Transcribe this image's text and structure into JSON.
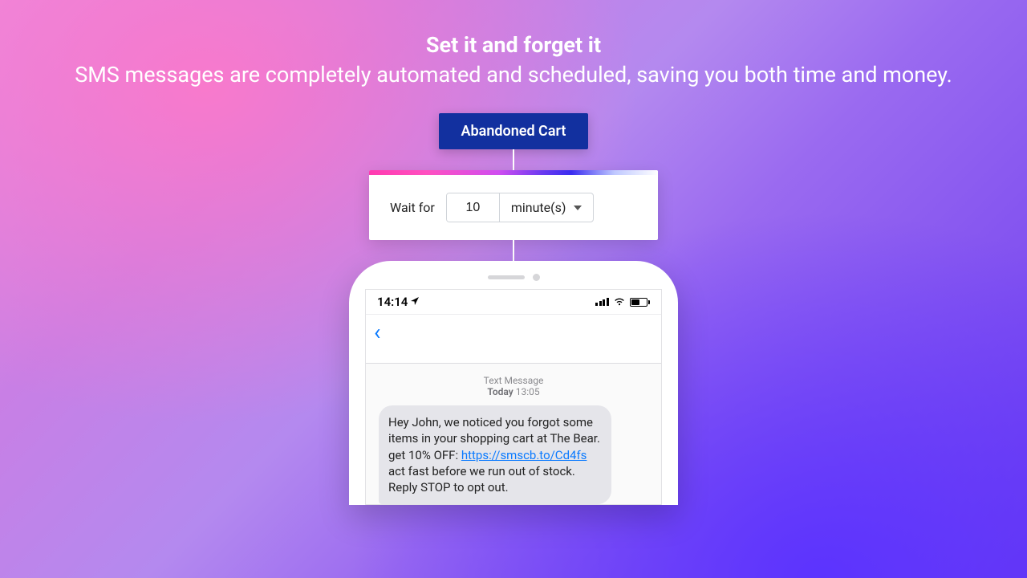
{
  "header": {
    "title": "Set it and forget it",
    "subtitle": "SMS messages are completely automated and scheduled, saving you both time and money."
  },
  "flow": {
    "tag": "Abandoned Cart",
    "wait_label": "Wait for",
    "wait_value": "10",
    "wait_unit": "minute(s)"
  },
  "phone": {
    "time": "14:14",
    "thread_header_line1": "Text Message",
    "thread_header_day": "Today",
    "thread_header_time": "13:05",
    "msg_part1": "Hey John, we noticed you forgot some items in your shopping cart at The Bear. get 10% OFF: ",
    "msg_link": "https://smscb.to/Cd4fs",
    "msg_part2": " act fast before we run out of stock. Reply STOP to opt out."
  }
}
